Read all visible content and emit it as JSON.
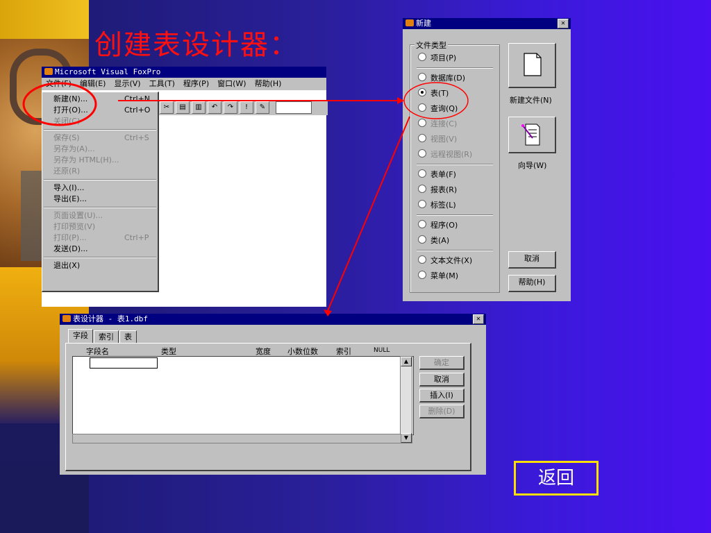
{
  "slide": {
    "title": "创建表设计器：",
    "back_label": "返回"
  },
  "vfp": {
    "title": "Microsoft Visual FoxPro",
    "menus": [
      "文件(F)",
      "编辑(E)",
      "显示(V)",
      "工具(T)",
      "程序(P)",
      "窗口(W)",
      "帮助(H)"
    ],
    "file_menu": [
      {
        "label": "新建(N)...",
        "shortcut": "Ctrl+N",
        "enabled": true
      },
      {
        "label": "打开(O)...",
        "shortcut": "Ctrl+O",
        "enabled": true
      },
      {
        "label": "关闭(C)",
        "shortcut": "",
        "enabled": false
      },
      {
        "label": "保存(S)",
        "shortcut": "Ctrl+S",
        "enabled": false
      },
      {
        "label": "另存为(A)...",
        "shortcut": "",
        "enabled": false
      },
      {
        "label": "另存为 HTML(H)...",
        "shortcut": "",
        "enabled": false
      },
      {
        "label": "还原(R)",
        "shortcut": "",
        "enabled": false
      },
      {
        "label": "导入(I)...",
        "shortcut": "",
        "enabled": true
      },
      {
        "label": "导出(E)...",
        "shortcut": "",
        "enabled": true
      },
      {
        "label": "页面设置(U)...",
        "shortcut": "",
        "enabled": false
      },
      {
        "label": "打印预览(V)",
        "shortcut": "",
        "enabled": false
      },
      {
        "label": "打印(P)...",
        "shortcut": "Ctrl+P",
        "enabled": false
      },
      {
        "label": "发送(D)...",
        "shortcut": "",
        "enabled": true
      },
      {
        "label": "退出(X)",
        "shortcut": "",
        "enabled": true
      }
    ],
    "toolbar_icons": [
      "cut-icon",
      "paste-icon",
      "copy-icon",
      "undo-icon",
      "redo-icon",
      "run-icon",
      "modify-icon"
    ]
  },
  "new_dialog": {
    "title": "新建",
    "group_label": "文件类型",
    "options": [
      {
        "label": "项目(P)",
        "selected": false,
        "enabled": true
      },
      {
        "label": "数据库(D)",
        "selected": false,
        "enabled": true
      },
      {
        "label": "表(T)",
        "selected": true,
        "enabled": true
      },
      {
        "label": "查询(Q)",
        "selected": false,
        "enabled": true
      },
      {
        "label": "连接(C)",
        "selected": false,
        "enabled": false
      },
      {
        "label": "视图(V)",
        "selected": false,
        "enabled": false
      },
      {
        "label": "远程视图(R)",
        "selected": false,
        "enabled": false
      },
      {
        "label": "表单(F)",
        "selected": false,
        "enabled": true
      },
      {
        "label": "报表(R)",
        "selected": false,
        "enabled": true
      },
      {
        "label": "标签(L)",
        "selected": false,
        "enabled": true
      },
      {
        "label": "程序(O)",
        "selected": false,
        "enabled": true
      },
      {
        "label": "类(A)",
        "selected": false,
        "enabled": true
      },
      {
        "label": "文本文件(X)",
        "selected": false,
        "enabled": true
      },
      {
        "label": "菜单(M)",
        "selected": false,
        "enabled": true
      }
    ],
    "new_file_label": "新建文件(N)",
    "wizard_label": "向导(W)",
    "cancel_label": "取消",
    "help_label": "帮助(H)"
  },
  "table_designer": {
    "title": "表设计器 - 表1.dbf",
    "tabs": [
      "字段",
      "索引",
      "表"
    ],
    "columns": [
      "字段名",
      "类型",
      "宽度",
      "小数位数",
      "索引",
      "NULL"
    ],
    "buttons": [
      {
        "label": "确定",
        "enabled": false
      },
      {
        "label": "取消",
        "enabled": true
      },
      {
        "label": "插入(I)",
        "enabled": true
      },
      {
        "label": "删除(D)",
        "enabled": false
      }
    ]
  },
  "colors": {
    "title_red": "#ff1010",
    "annotation_red": "#ff0000",
    "back_border": "#ffe000",
    "titlebar": "#000080"
  }
}
